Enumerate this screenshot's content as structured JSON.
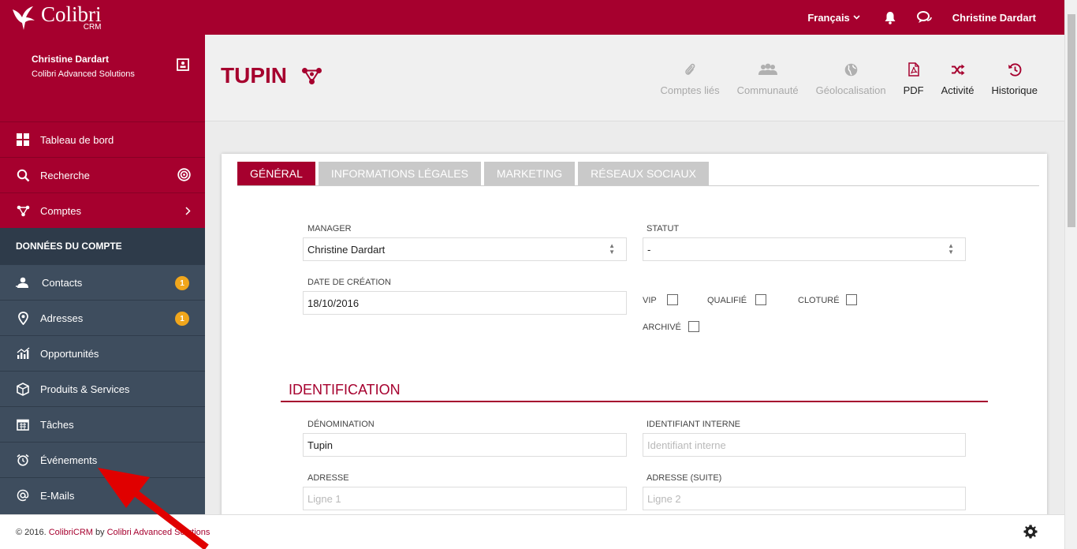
{
  "app": {
    "logo_name": "Colibri",
    "logo_sub": "CRM",
    "language": "Français",
    "user_name": "Christine Dardart"
  },
  "sidebar": {
    "user_name": "Christine Dardart",
    "user_company": "Colibri Advanced Solutions",
    "top_items": [
      {
        "label": "Tableau de bord",
        "icon": "dashboard-icon"
      },
      {
        "label": "Recherche",
        "icon": "search-icon"
      },
      {
        "label": "Comptes",
        "icon": "accounts-icon"
      }
    ],
    "section_title": "DONNÉES DU COMPTE",
    "items": [
      {
        "label": "Contacts",
        "icon": "contacts-icon",
        "badge": "1"
      },
      {
        "label": "Adresses",
        "icon": "address-pin-icon",
        "badge": "1"
      },
      {
        "label": "Opportunités",
        "icon": "chart-icon"
      },
      {
        "label": "Produits & Services",
        "icon": "cube-icon"
      },
      {
        "label": "Tâches",
        "icon": "calendar-icon"
      },
      {
        "label": "Événements",
        "icon": "alarm-clock-icon"
      },
      {
        "label": "E-Mails",
        "icon": "at-icon"
      }
    ]
  },
  "header": {
    "title": "TUPIN",
    "toolbar": [
      {
        "label": "Comptes liés",
        "icon": "paperclip-icon",
        "state": "disabled"
      },
      {
        "label": "Communauté",
        "icon": "group-icon",
        "state": "disabled"
      },
      {
        "label": "Géolocalisation",
        "icon": "globe-icon",
        "state": "disabled"
      },
      {
        "label": "PDF",
        "icon": "pdf-icon",
        "state": "active"
      },
      {
        "label": "Activité",
        "icon": "shuffle-icon",
        "state": "active"
      },
      {
        "label": "Historique",
        "icon": "history-icon",
        "state": "active"
      }
    ]
  },
  "tabs": [
    "GÉNÉRAL",
    "INFORMATIONS LÉGALES",
    "MARKETING",
    "RÉSEAUX SOCIAUX"
  ],
  "form": {
    "manager_label": "MANAGER",
    "manager_value": "Christine Dardart",
    "statut_label": "STATUT",
    "statut_value": "-",
    "date_label": "DATE DE CRÉATION",
    "date_value": "18/10/2016",
    "vip_label": "VIP",
    "qualifie_label": "QUALIFIÉ",
    "cloture_label": "CLOTURÉ",
    "archive_label": "ARCHIVÉ",
    "identification_title": "IDENTIFICATION",
    "denomination_label": "DÉNOMINATION",
    "denomination_value": "Tupin",
    "id_interne_label": "IDENTIFIANT INTERNE",
    "id_interne_placeholder": "Identifiant interne",
    "adresse_label": "ADRESSE",
    "adresse_placeholder": "Ligne 1",
    "adresse_suite_label": "ADRESSE (SUITE)",
    "adresse_suite_placeholder": "Ligne 2"
  },
  "footer": {
    "copyright": "© 2016.",
    "product": "ColibriCRM",
    "by": "by",
    "company": "Colibri Advanced Solutions"
  },
  "colors": {
    "brand": "#a6002e",
    "sidebar": "#3e4d5e",
    "badge": "#f0a61c",
    "annotation_arrow": "#e00000"
  }
}
